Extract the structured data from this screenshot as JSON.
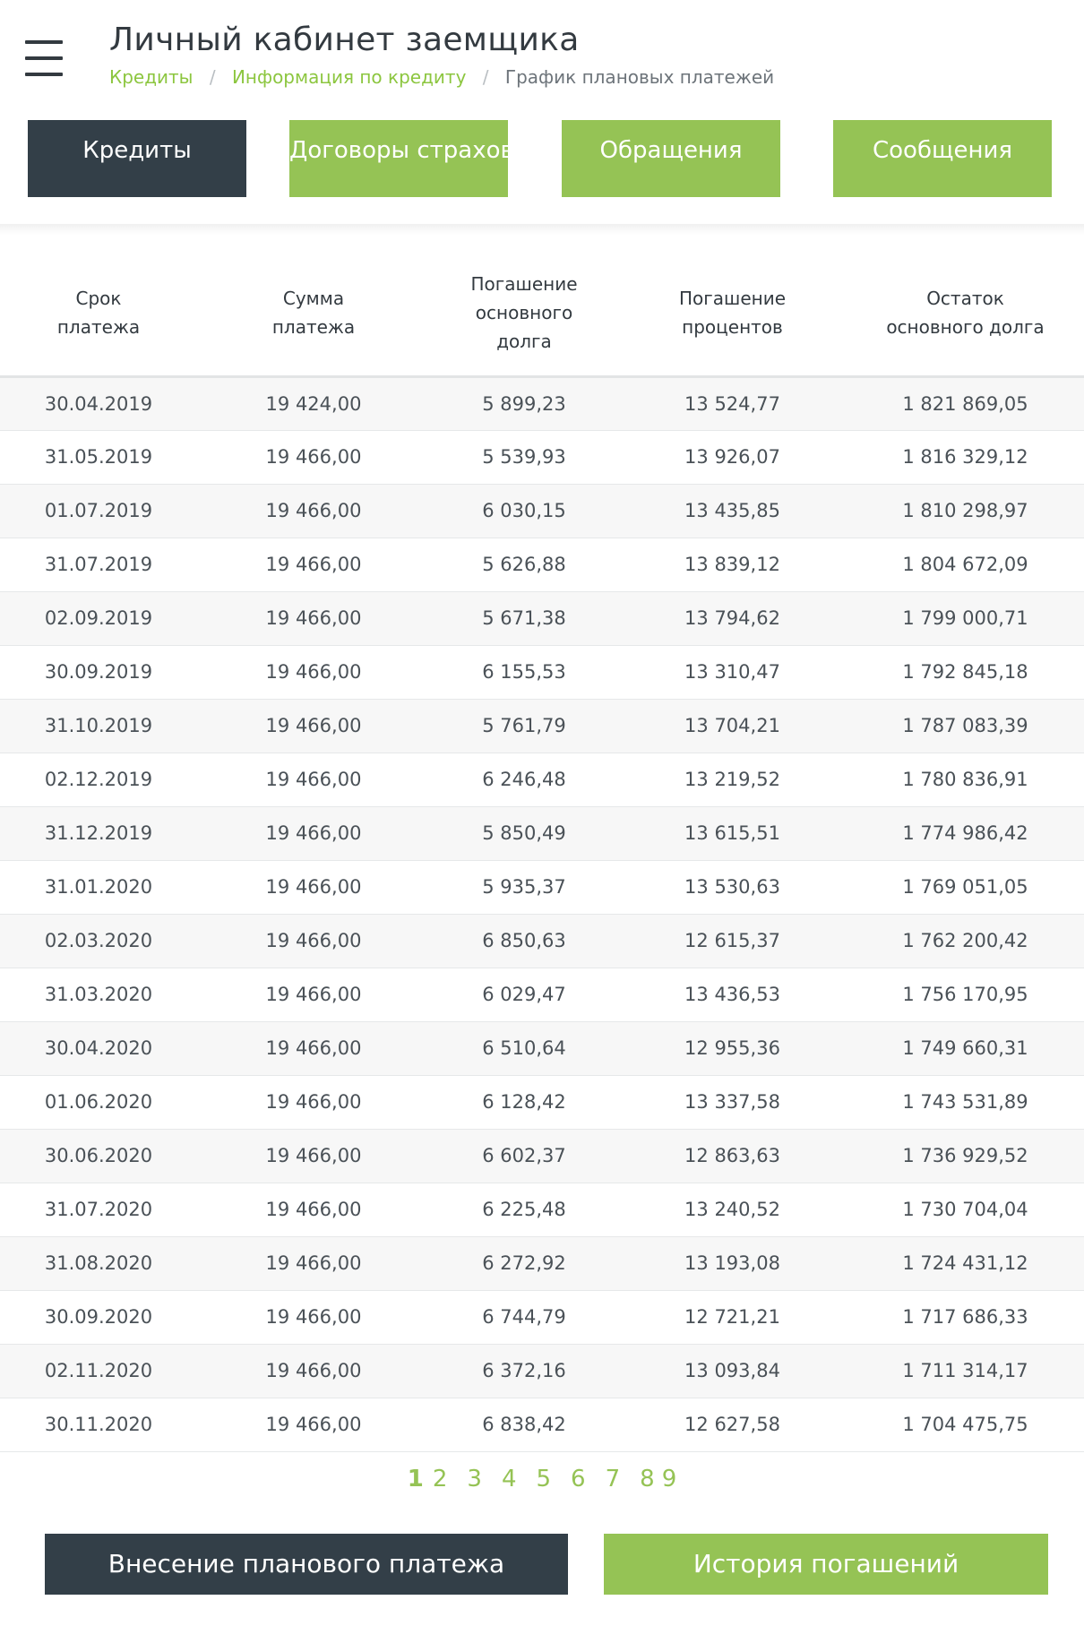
{
  "header": {
    "title": "Личный кабинет заемщика",
    "breadcrumb": {
      "items": [
        "Кредиты",
        "Информация по кредиту",
        "График плановых платежей"
      ],
      "separator": "/"
    }
  },
  "tabs": [
    {
      "label": "Кредиты",
      "active": true
    },
    {
      "label": "Договоры страхования",
      "active": false
    },
    {
      "label": "Обращения",
      "active": false
    },
    {
      "label": "Сообщения",
      "active": false
    }
  ],
  "table": {
    "columns": [
      "Срок платежа",
      "Сумма платежа",
      "Погашение основного долга",
      "Погашение процентов",
      "Остаток основного долга"
    ],
    "rows": [
      [
        "30.04.2019",
        "19 424,00",
        "5 899,23",
        "13 524,77",
        "1 821 869,05"
      ],
      [
        "31.05.2019",
        "19 466,00",
        "5 539,93",
        "13 926,07",
        "1 816 329,12"
      ],
      [
        "01.07.2019",
        "19 466,00",
        "6 030,15",
        "13 435,85",
        "1 810 298,97"
      ],
      [
        "31.07.2019",
        "19 466,00",
        "5 626,88",
        "13 839,12",
        "1 804 672,09"
      ],
      [
        "02.09.2019",
        "19 466,00",
        "5 671,38",
        "13 794,62",
        "1 799 000,71"
      ],
      [
        "30.09.2019",
        "19 466,00",
        "6 155,53",
        "13 310,47",
        "1 792 845,18"
      ],
      [
        "31.10.2019",
        "19 466,00",
        "5 761,79",
        "13 704,21",
        "1 787 083,39"
      ],
      [
        "02.12.2019",
        "19 466,00",
        "6 246,48",
        "13 219,52",
        "1 780 836,91"
      ],
      [
        "31.12.2019",
        "19 466,00",
        "5 850,49",
        "13 615,51",
        "1 774 986,42"
      ],
      [
        "31.01.2020",
        "19 466,00",
        "5 935,37",
        "13 530,63",
        "1 769 051,05"
      ],
      [
        "02.03.2020",
        "19 466,00",
        "6 850,63",
        "12 615,37",
        "1 762 200,42"
      ],
      [
        "31.03.2020",
        "19 466,00",
        "6 029,47",
        "13 436,53",
        "1 756 170,95"
      ],
      [
        "30.04.2020",
        "19 466,00",
        "6 510,64",
        "12 955,36",
        "1 749 660,31"
      ],
      [
        "01.06.2020",
        "19 466,00",
        "6 128,42",
        "13 337,58",
        "1 743 531,89"
      ],
      [
        "30.06.2020",
        "19 466,00",
        "6 602,37",
        "12 863,63",
        "1 736 929,52"
      ],
      [
        "31.07.2020",
        "19 466,00",
        "6 225,48",
        "13 240,52",
        "1 730 704,04"
      ],
      [
        "31.08.2020",
        "19 466,00",
        "6 272,92",
        "13 193,08",
        "1 724 431,12"
      ],
      [
        "30.09.2020",
        "19 466,00",
        "6 744,79",
        "12 721,21",
        "1 717 686,33"
      ],
      [
        "02.11.2020",
        "19 466,00",
        "6 372,16",
        "13 093,84",
        "1 711 314,17"
      ],
      [
        "30.11.2020",
        "19 466,00",
        "6 838,42",
        "12 627,58",
        "1 704 475,75"
      ]
    ]
  },
  "pagination": {
    "pages": [
      "1",
      "2",
      "3",
      "4",
      "5",
      "6",
      "7",
      "8",
      "9"
    ],
    "current": "1"
  },
  "actions": {
    "payment_label": "Внесение планового платежа",
    "history_label": "История погашений"
  },
  "colors": {
    "accent_green": "#95c355",
    "dark": "#333f48"
  }
}
